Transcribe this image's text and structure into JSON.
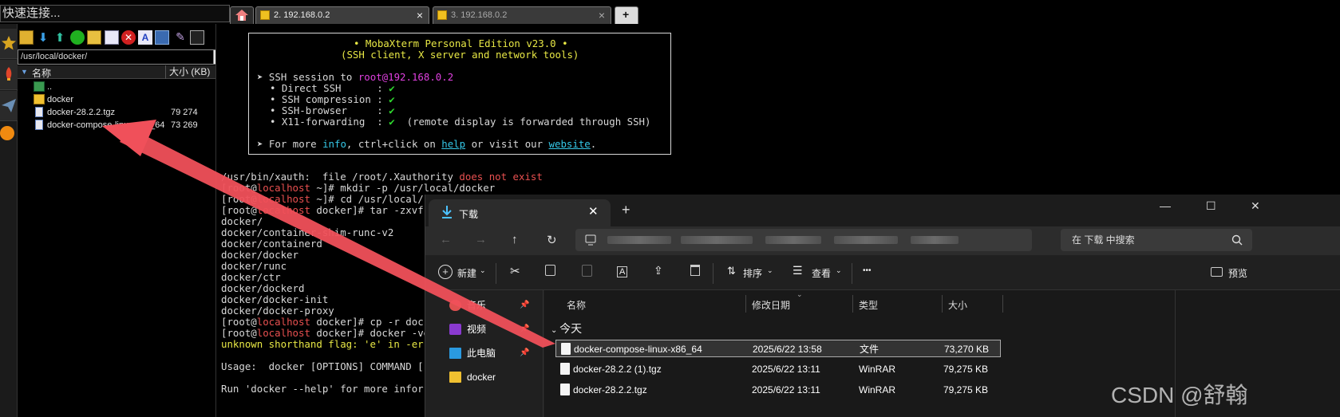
{
  "moba": {
    "quick_connect": "快速连接...",
    "sftp": {
      "path": "/usr/local/docker/",
      "col_name": "名称",
      "col_size": "大小 (KB)",
      "files": [
        {
          "name": "..",
          "size": "",
          "icon": "folder-up-icon"
        },
        {
          "name": "docker",
          "size": "",
          "icon": "folder-icon"
        },
        {
          "name": "docker-28.2.2.tgz",
          "size": "79 274",
          "icon": "archive-file-icon"
        },
        {
          "name": "docker-compose-linux-x86_64",
          "size": "73 269",
          "icon": "file-icon"
        }
      ]
    },
    "tabs": [
      {
        "label": "2. 192.168.0.2",
        "active": true
      },
      {
        "label": "3. 192.168.0.2",
        "active": false
      }
    ],
    "banner": {
      "line1": "• MobaXterm Personal Edition v23.0 •",
      "line2": "(SSH client, X server and network tools)",
      "ssh_prefix": "➤ SSH session to ",
      "ssh_host": "root@192.168.0.2",
      "features": [
        {
          "label": "• Direct SSH      :",
          "mark": "✔",
          "note": ""
        },
        {
          "label": "• SSH compression :",
          "mark": "✔",
          "note": ""
        },
        {
          "label": "• SSH-browser     :",
          "mark": "✔",
          "note": ""
        },
        {
          "label": "• X11-forwarding  :",
          "mark": "✔",
          "note": "(remote display is forwarded through SSH)"
        }
      ],
      "more_prefix": "➤ For more ",
      "more_info": "info",
      "more_mid": ", ctrl+click on ",
      "more_help": "help",
      "more_mid2": " or visit our ",
      "more_website": "website",
      "more_end": "."
    },
    "terminal": {
      "xauth": "/usr/bin/xauth:  file /root/.Xauthority ",
      "xauth_err": "does not exist",
      "prompt_open": "[root@",
      "host": "localhost",
      "lines": [
        {
          "dir": " ~]# ",
          "cmd": "mkdir -p /usr/local/docker"
        },
        {
          "dir": " ~]# ",
          "cmd": "cd /usr/local/"
        },
        {
          "dir": " docker]# ",
          "cmd": "tar -zxvf"
        }
      ],
      "output": [
        "docker/",
        "docker/container-shim-runc-v2",
        "docker/containerd",
        "docker/docker",
        "docker/runc",
        "docker/ctr",
        "docker/dockerd",
        "docker/docker-init",
        "docker/docker-proxy"
      ],
      "lines2": [
        {
          "dir": " docker]# ",
          "cmd": "cp -r dock"
        },
        {
          "dir": " docker]# ",
          "cmd": "docker -ve"
        }
      ],
      "err_line": "unknown shorthand flag: 'e' in -err",
      "usage": "Usage:  docker [OPTIONS] COMMAND [",
      "run_line": "Run 'docker --help' for more infor"
    }
  },
  "explorer": {
    "tab_title": "下载",
    "search_placeholder": "在 下载 中搜索",
    "commands": {
      "new": "新建",
      "sort": "排序",
      "view": "查看",
      "more": "•••",
      "preview": "预览"
    },
    "nav_items": [
      {
        "label": "音乐",
        "icon": "music-icon",
        "pinned": true
      },
      {
        "label": "视频",
        "icon": "video-icon",
        "pinned": true
      },
      {
        "label": "此电脑",
        "icon": "computer-icon",
        "pinned": true
      },
      {
        "label": "docker",
        "icon": "folder-icon",
        "pinned": false
      }
    ],
    "columns": {
      "name": "名称",
      "modified": "修改日期",
      "type": "类型",
      "size": "大小"
    },
    "group": "今天",
    "rows": [
      {
        "name": "docker-compose-linux-x86_64",
        "modified": "2025/6/22 13:58",
        "type": "文件",
        "size": "73,270 KB",
        "selected": true
      },
      {
        "name": "docker-28.2.2 (1).tgz",
        "modified": "2025/6/22 13:11",
        "type": "WinRAR",
        "size": "79,275 KB",
        "selected": false
      },
      {
        "name": "docker-28.2.2.tgz",
        "modified": "2025/6/22 13:11",
        "type": "WinRAR",
        "size": "79,275 KB",
        "selected": false
      }
    ]
  },
  "watermark": "CSDN @舒翰",
  "colors": {
    "accent_red": "#f0505a",
    "terminal_green": "#2fd82f",
    "terminal_yellow": "#e8e845",
    "host_red": "#e85050"
  }
}
